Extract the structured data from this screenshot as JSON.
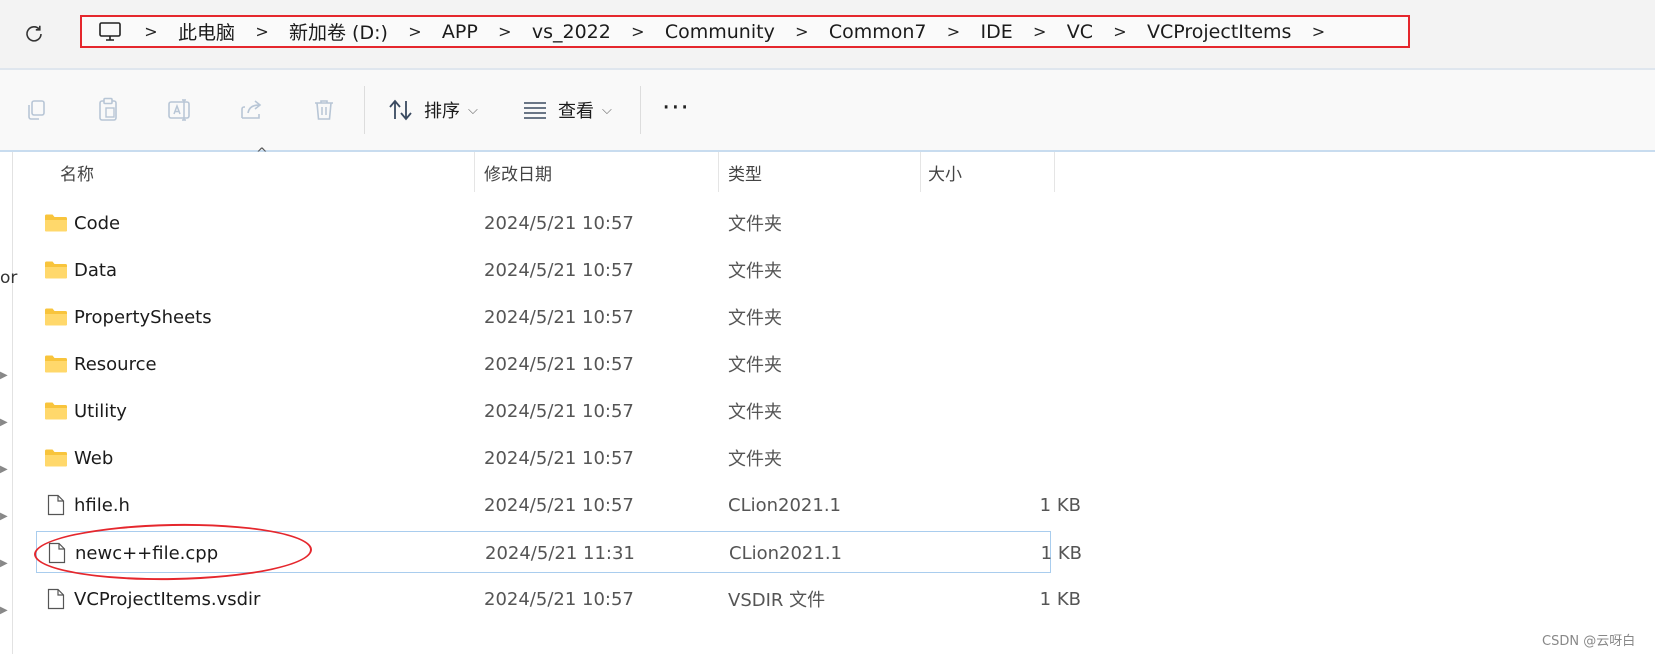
{
  "address_bar": {
    "crumbs": [
      "此电脑",
      "新加卷 (D:)",
      "APP",
      "vs_2022",
      "Community",
      "Common7",
      "IDE",
      "VC",
      "VCProjectItems"
    ],
    "separator": ">"
  },
  "command_bar": {
    "sort_label": "排序",
    "view_label": "查看",
    "more_label": "···",
    "chevron": "⌵"
  },
  "columns": {
    "name": "名称",
    "date": "修改日期",
    "type": "类型",
    "size": "大小",
    "sort_caret": "^"
  },
  "files": [
    {
      "name": "Code",
      "date": "2024/5/21 10:57",
      "type": "文件夹",
      "size": "",
      "icon": "folder-icon"
    },
    {
      "name": "Data",
      "date": "2024/5/21 10:57",
      "type": "文件夹",
      "size": "",
      "icon": "folder-icon"
    },
    {
      "name": "PropertySheets",
      "date": "2024/5/21 10:57",
      "type": "文件夹",
      "size": "",
      "icon": "folder-icon"
    },
    {
      "name": "Resource",
      "date": "2024/5/21 10:57",
      "type": "文件夹",
      "size": "",
      "icon": "folder-icon"
    },
    {
      "name": "Utility",
      "date": "2024/5/21 10:57",
      "type": "文件夹",
      "size": "",
      "icon": "folder-icon"
    },
    {
      "name": "Web",
      "date": "2024/5/21 10:57",
      "type": "文件夹",
      "size": "",
      "icon": "folder-icon"
    },
    {
      "name": "hfile.h",
      "date": "2024/5/21 10:57",
      "type": "CLion2021.1",
      "size": "1 KB",
      "icon": "file-icon"
    },
    {
      "name": "newc++file.cpp",
      "date": "2024/5/21 11:31",
      "type": "CLion2021.1",
      "size": "1 KB",
      "icon": "file-icon"
    },
    {
      "name": "VCProjectItems.vsdir",
      "date": "2024/5/21 10:57",
      "type": "VSDIR 文件",
      "size": "1 KB",
      "icon": "file-icon"
    }
  ],
  "left_edge_text": "or",
  "watermark": "CSDN @云呀白",
  "colors": {
    "highlight_red": "#e5272d",
    "folder_yellow": "#f8c43c",
    "selection_border": "#a9cdee"
  }
}
